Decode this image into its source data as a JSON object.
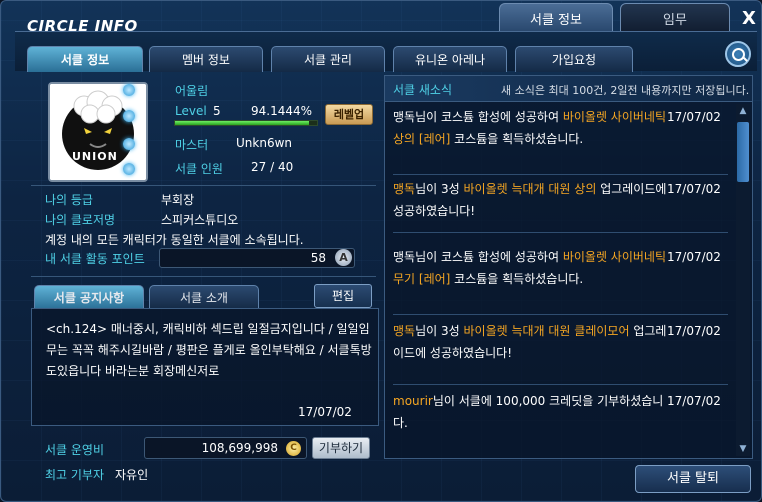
{
  "window": {
    "title": "CIRCLE INFO",
    "close_label": "X"
  },
  "top_tabs": [
    {
      "label": "서클 정보"
    },
    {
      "label": "임무"
    }
  ],
  "sub_tabs": [
    {
      "label": "서클 정보"
    },
    {
      "label": "멤버 정보"
    },
    {
      "label": "서클 관리"
    },
    {
      "label": "유니온 아레나"
    },
    {
      "label": "가입요청"
    }
  ],
  "circle": {
    "name": "어울림",
    "level_label": "Level",
    "level": "5",
    "level_percent": "94.1444%",
    "level_fraction": 0.941444,
    "levelup_label": "레벨업",
    "master_label": "마스터",
    "master": "Unkn6wn",
    "members_label": "서클 인원",
    "members": "27 / 40",
    "logo_text": "UNION"
  },
  "my_info": {
    "grade_label": "나의 등급",
    "grade": "부회장",
    "title_label": "나의 클로저명",
    "title": "스피커스튜디오",
    "notice": "계정 내의 모든 캐릭터가 동일한 서클에 소속됩니다.",
    "points_label": "내 서클 활동 포인트",
    "points": "58",
    "points_icon": "A"
  },
  "notice_tabs": [
    {
      "label": "서클 공지사항"
    },
    {
      "label": "서클 소개"
    }
  ],
  "edit_label": "편집",
  "notice": {
    "text": "<ch.124> 매너중시, 캐릭비하 섹드립 일절금지입니다 / 일일임무는 꼭꼭 해주시길바람 / 평판은 플게로 올인부탁해요 / 서클톡방도있읍니다 바라는분 회장메신저로",
    "date": "17/07/02"
  },
  "funds": {
    "label": "서클 운영비",
    "value": "108,699,998",
    "coin_icon": "C",
    "donate_label": "기부하기",
    "top_donor_label": "최고 기부자",
    "top_donor": "자유인"
  },
  "news": {
    "title": "서클 새소식",
    "note": "새 소식은 최대 100건, 2일전 내용까지만 저장됩니다.",
    "items": [
      {
        "p1": "맹독님이 코스튬 합성에 성공하여 ",
        "h1": "바이올렛 사이버네틱 상의 [레어]",
        "p2": " 코스튬을 획득하셨습니다.",
        "date": "17/07/02"
      },
      {
        "p1": "",
        "h0": "맹독",
        "p1b": "님이 3성 ",
        "h1": "바이올렛 늑대개 대원 상의",
        "p2": " 업그레이드에 성공하였습니다!",
        "date": "17/07/02"
      },
      {
        "p1": "맹독님이 코스튬 합성에 성공하여 ",
        "h1": "바이올렛 사이버네틱 무기 [레어]",
        "p2": " 코스튬을 획득하셨습니다.",
        "date": "17/07/02"
      },
      {
        "p1": "",
        "h0": "맹독",
        "p1b": "님이 3성 ",
        "h1": "바이올렛 늑대개 대원 클레이모어",
        "p2": " 업그레이드에 성공하였습니다!",
        "date": "17/07/02"
      },
      {
        "p1": "",
        "h0": "mourir",
        "p1b": "님이 서클에 100,000 크레딧을 기부하셨습니다.",
        "h1": "",
        "p2": "",
        "date": "17/07/02"
      }
    ]
  },
  "leave_label": "서클 탈퇴",
  "colors": {
    "accent_cyan": "#4fd1e6",
    "highlight_orange": "#f5a623",
    "level_green": "#4fd43f"
  }
}
